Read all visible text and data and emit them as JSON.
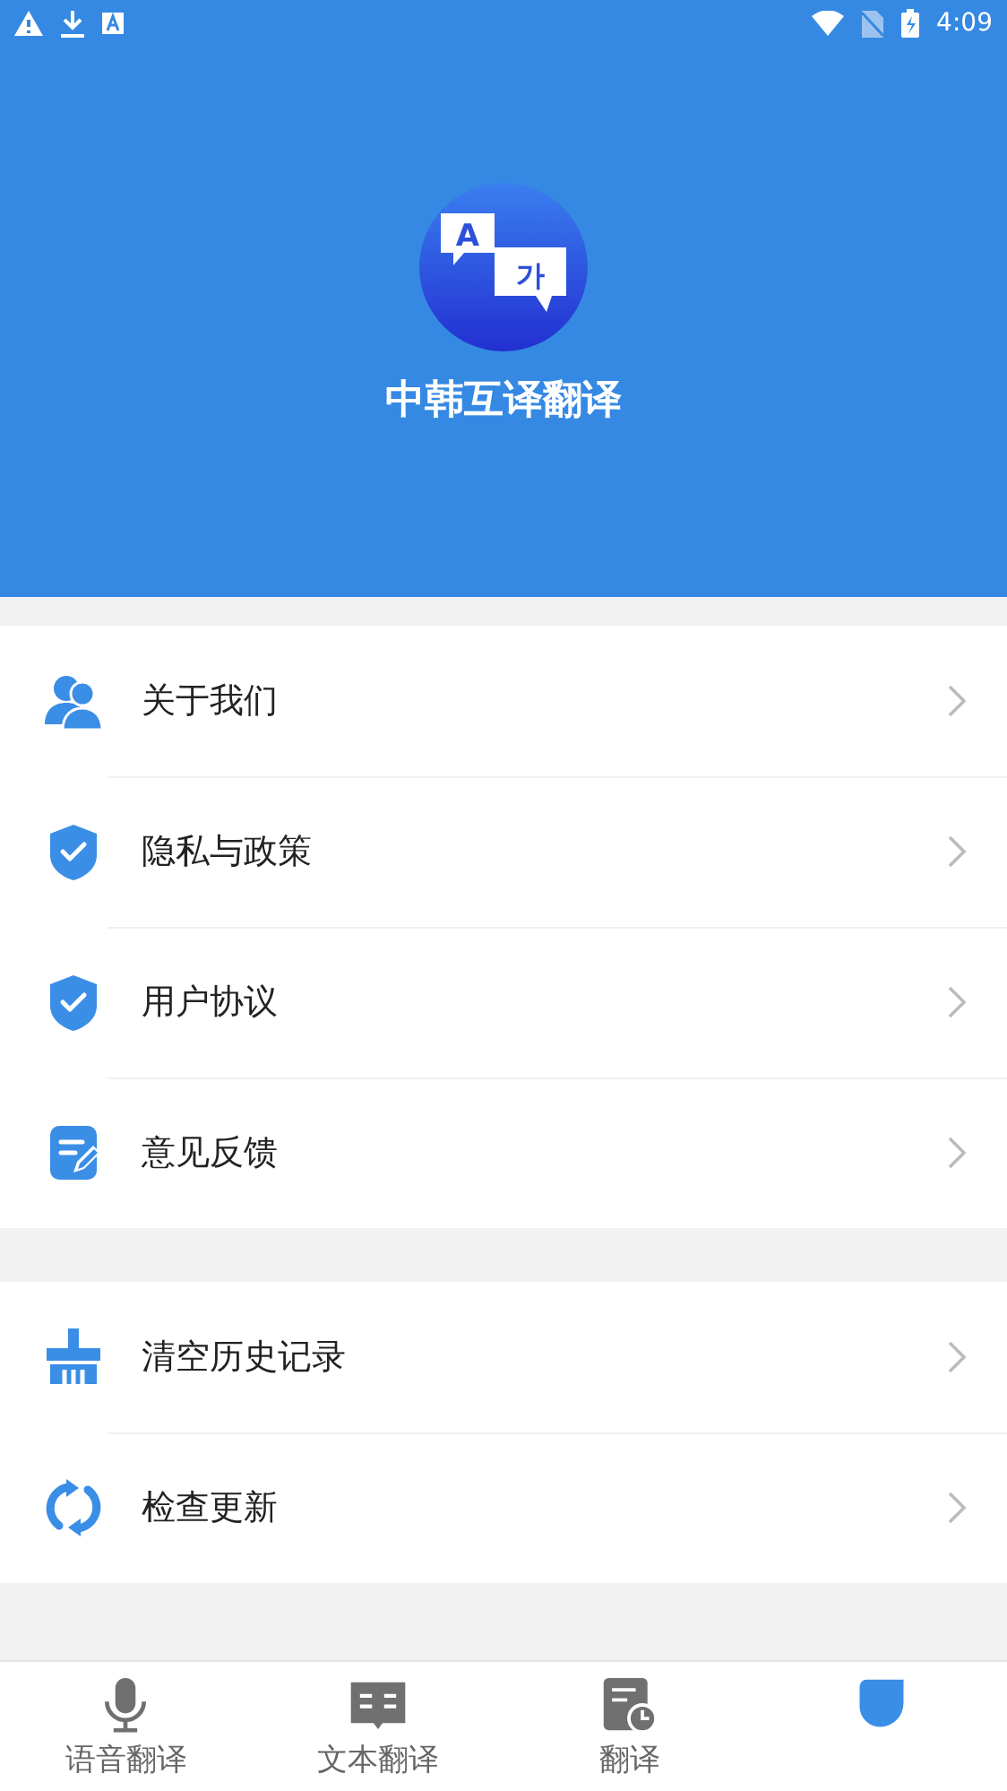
{
  "status_bar": {
    "time": "4:09"
  },
  "header": {
    "app_name": "中韩互译翻译",
    "logo_letters": [
      "A",
      "가"
    ]
  },
  "menu_groups": [
    {
      "items": [
        {
          "label": "关于我们",
          "kind": "people"
        },
        {
          "label": "隐私与政策",
          "kind": "shield"
        },
        {
          "label": "用户协议",
          "kind": "shield"
        },
        {
          "label": "意见反馈",
          "kind": "feedback"
        }
      ]
    },
    {
      "items": [
        {
          "label": "清空历史记录",
          "kind": "broom"
        },
        {
          "label": "检查更新",
          "kind": "refresh"
        }
      ]
    }
  ],
  "tabs": [
    {
      "label": "语音翻译",
      "kind": "mic",
      "selected": false
    },
    {
      "label": "文本翻译",
      "kind": "book",
      "selected": false
    },
    {
      "label": "翻译",
      "kind": "history",
      "selected": false
    },
    {
      "kind": "profile",
      "selected": true
    }
  ]
}
